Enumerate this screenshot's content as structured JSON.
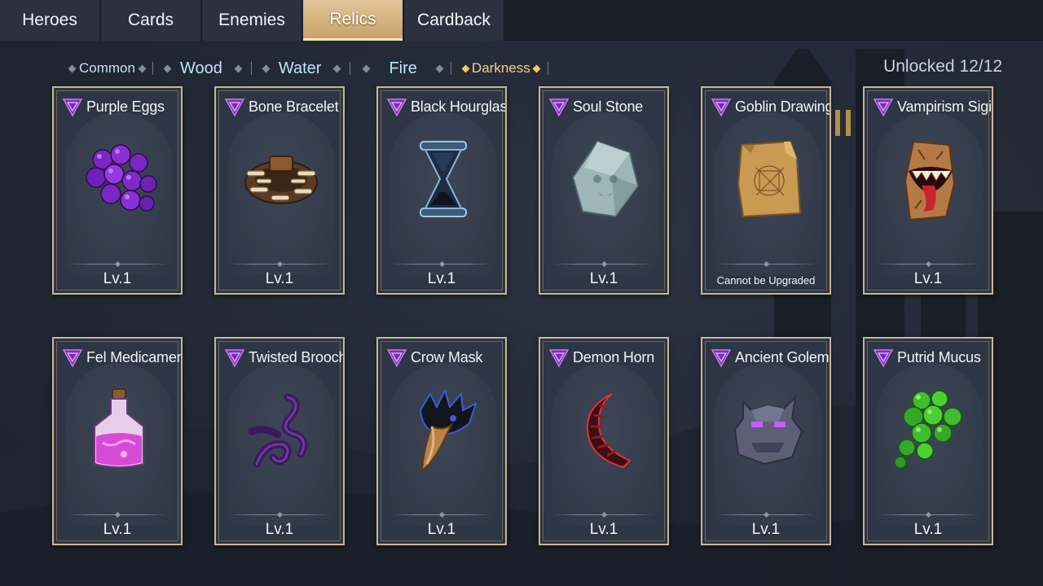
{
  "top_tabs": [
    {
      "label": "Heroes",
      "active": false
    },
    {
      "label": "Cards",
      "active": false
    },
    {
      "label": "Enemies",
      "active": false
    },
    {
      "label": "Relics",
      "active": true
    },
    {
      "label": "Cardback",
      "active": false
    }
  ],
  "filters": [
    {
      "label": "Common",
      "active": false
    },
    {
      "label": "Wood",
      "active": false
    },
    {
      "label": "Water",
      "active": false
    },
    {
      "label": "Fire",
      "active": false
    },
    {
      "label": "Darkness",
      "active": true
    }
  ],
  "unlocked": "Unlocked 12/12",
  "relics": [
    {
      "name": "Purple Eggs",
      "level": "Lv.1",
      "icon": "purple-eggs-icon"
    },
    {
      "name": "Bone Bracelet",
      "level": "Lv.1",
      "icon": "bone-bracelet-icon"
    },
    {
      "name": "Black Hourglass",
      "level": "Lv.1",
      "icon": "black-hourglass-icon"
    },
    {
      "name": "Soul Stone",
      "level": "Lv.1",
      "icon": "soul-stone-icon"
    },
    {
      "name": "Goblin Drawing",
      "level": "Cannot be Upgraded",
      "icon": "goblin-drawing-icon"
    },
    {
      "name": "Vampirism Sigil",
      "level": "Lv.1",
      "icon": "vampirism-sigil-icon"
    },
    {
      "name": "Fel Medicament",
      "level": "Lv.1",
      "icon": "fel-medicament-icon"
    },
    {
      "name": "Twisted Brooch",
      "level": "Lv.1",
      "icon": "twisted-brooch-icon"
    },
    {
      "name": "Crow Mask",
      "level": "Lv.1",
      "icon": "crow-mask-icon"
    },
    {
      "name": "Demon Horn",
      "level": "Lv.1",
      "icon": "demon-horn-icon"
    },
    {
      "name": "Ancient Golem",
      "level": "Lv.1",
      "icon": "ancient-golem-icon"
    },
    {
      "name": "Putrid Mucus",
      "level": "Lv.1",
      "icon": "putrid-mucus-icon"
    }
  ],
  "colors": {
    "accent_gold": "#d9b985",
    "darkness_purple": "#a53ee0",
    "active_filter": "#f5d27d",
    "filter_text": "#bfe3f6"
  }
}
